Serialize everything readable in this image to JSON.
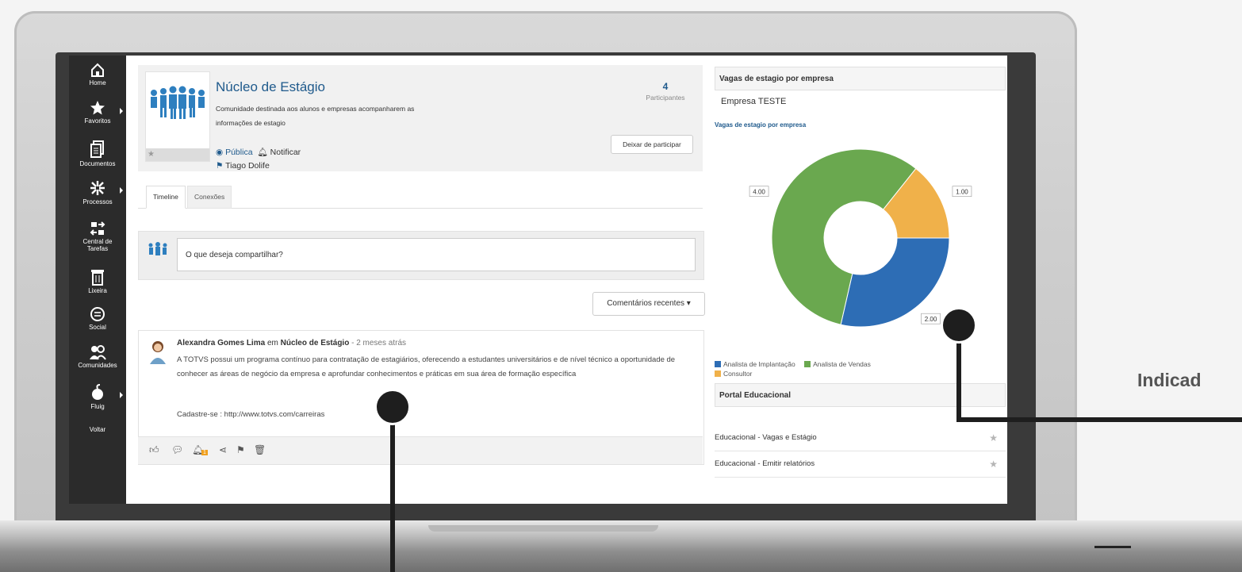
{
  "sidebar": {
    "items": [
      {
        "label": "Home",
        "icon": "home-icon"
      },
      {
        "label": "Favoritos",
        "icon": "star-icon"
      },
      {
        "label": "Documentos",
        "icon": "documents-icon"
      },
      {
        "label": "Processos",
        "icon": "processes-icon"
      },
      {
        "label": "Central de Tarefas",
        "icon": "tasks-icon"
      },
      {
        "label": "Lixeira",
        "icon": "trash-icon"
      },
      {
        "label": "Social",
        "icon": "social-icon"
      },
      {
        "label": "Comunidades",
        "icon": "communities-icon"
      },
      {
        "label": "Fluig",
        "icon": "fluig-icon"
      },
      {
        "label": "Voltar"
      }
    ]
  },
  "community": {
    "title": "Núcleo de Estágio",
    "description": "Comunidade destinada aos alunos e empresas acompanharem as informações de estagio",
    "visibility": "Pública",
    "notify": "Notificar",
    "owner": "Tiago Dolife",
    "participants_count": "4",
    "participants_label": "Participantes",
    "leave_button": "Deixar de participar"
  },
  "tabs": [
    {
      "label": "Timeline",
      "active": true
    },
    {
      "label": "Conexões",
      "active": false
    }
  ],
  "share": {
    "placeholder": "O que deseja compartilhar?"
  },
  "recent_comments_button": "Comentários recentes ▾",
  "post": {
    "author": "Alexandra Gomes Lima",
    "in_word": "em",
    "community": "Núcleo de Estágio",
    "time": "- 2 meses atrás",
    "text": "A TOTVS possui um programa contínuo para contratação de estagiários, oferecendo a estudantes universitários e de nível técnico a oportunidade de conhecer as áreas de negócio da empresa e aprofundar conhecimentos e práticas em sua área de formação específica",
    "link": "Cadastre-se : http://www.totvs.com/carreiras",
    "notification_badge": "1"
  },
  "right_panel": {
    "title": "Vagas de estagio por empresa",
    "company": "Empresa TESTE",
    "chart_title": "Vagas de estagio por empresa",
    "portal_title": "Portal Educacional",
    "portal_items": [
      "Educacional - Vagas e Estágio",
      "Educacional - Emitir relatórios"
    ]
  },
  "chart_data": {
    "type": "pie",
    "title": "Vagas de estagio por empresa",
    "categories": [
      "Analista de Implantação",
      "Analista de Vendas",
      "Consultor"
    ],
    "values": [
      2,
      4,
      1
    ],
    "value_labels": [
      "2.00",
      "4.00",
      "1.00"
    ],
    "colors": [
      "#2d6db5",
      "#6aa84f",
      "#f0b14a"
    ],
    "donut": true,
    "legend": "bottom-left"
  },
  "callout": {
    "label": "Indicad"
  },
  "colors": {
    "accent": "#1f5a8c",
    "sidebar": "#2b2b2b"
  }
}
